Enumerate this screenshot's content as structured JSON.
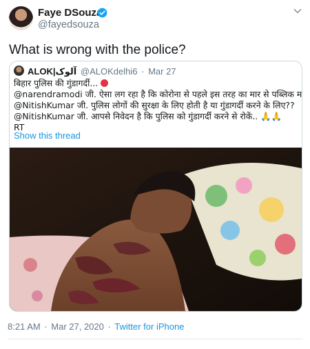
{
  "author": {
    "name": "Faye DSouza",
    "handle": "@fayedsouza",
    "verified": true
  },
  "tweet": {
    "text": "What is wrong with the police?"
  },
  "quoted_tweet": {
    "name": "ALOK|آلوک",
    "handle": "@ALOKdelhi6",
    "separator": "·",
    "date": "Mar 27",
    "lines": [
      "बिहार पुलिस की गुंडागर्दी...",
      "@narendramodi जी. ऐसा लग रहा है कि कोरोना से पहले इस तरह का मार से पब्लिक मर जायेगा,",
      "@NitishKumar जी. पुलिस लोगों की सुरक्षा के लिए होती है या गुंडागर्दी करने के लिए??",
      "@NitishKumar जी. आपसे निवेदन है कि पुलिस को गुंडागर्दी करने से रोकें.. 🙏🙏",
      "RT"
    ],
    "show_thread": "Show this thread"
  },
  "footer": {
    "time": "8:21 AM",
    "separator": "·",
    "date": "Mar 27, 2020",
    "source": "Twitter for iPhone"
  },
  "colors": {
    "link": "#1b95e0",
    "secondary": "#657786",
    "border": "#ccd6dd",
    "verified": "#1da1f2"
  },
  "icons": [
    "verified-badge-icon",
    "chevron-down-icon",
    "angry-face-emoji"
  ]
}
